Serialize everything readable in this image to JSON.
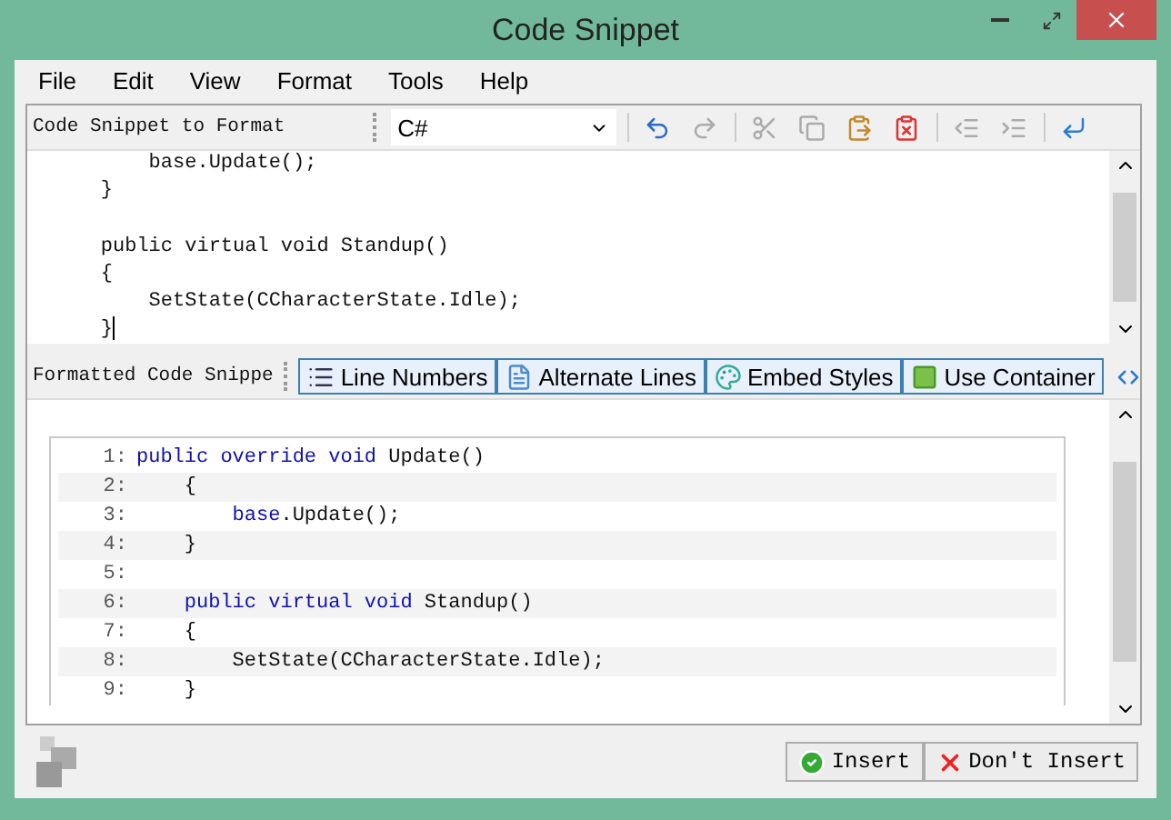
{
  "window": {
    "title": "Code Snippet"
  },
  "menu": [
    "File",
    "Edit",
    "View",
    "Format",
    "Tools",
    "Help"
  ],
  "source_toolbar": {
    "label": "Code Snippet to Format",
    "language": "C#"
  },
  "source_lines": [
    {
      "text": "        base.Update();"
    },
    {
      "text": "    }"
    },
    {
      "text": "    public virtual void Standup()",
      "blank_before": true
    },
    {
      "text": "    {"
    },
    {
      "text": "        SetState(CCharacterState.Idle);"
    },
    {
      "text": "    }"
    }
  ],
  "format_toolbar": {
    "label": "Formatted Code Snippe",
    "toggles": [
      {
        "label": "Line Numbers",
        "kind": "lines",
        "checked": true
      },
      {
        "label": "Alternate Lines",
        "kind": "page",
        "checked": true
      },
      {
        "label": "Embed Styles",
        "kind": "styles",
        "checked": true
      },
      {
        "label": "Use Container",
        "kind": "container",
        "checked": true
      }
    ]
  },
  "preview_lines": [
    {
      "number": "1:",
      "parts": [
        {
          "text": "public override void",
          "kind": "keyword"
        },
        {
          "text": " Update()",
          "kind": "plain"
        }
      ]
    },
    {
      "number": "2:",
      "parts": [
        {
          "text": "    {",
          "kind": "plain"
        }
      ]
    },
    {
      "number": "3:",
      "parts": [
        {
          "text": "        base",
          "kind": "keyword"
        },
        {
          "text": ".Update();",
          "kind": "plain"
        }
      ]
    },
    {
      "number": "4:",
      "parts": [
        {
          "text": "    }",
          "kind": "plain"
        }
      ]
    },
    {
      "number": "5:"
    },
    {
      "number": "6:",
      "parts": [
        {
          "text": "    public virtual void",
          "kind": "keyword"
        },
        {
          "text": " Standup()",
          "kind": "plain"
        }
      ]
    },
    {
      "number": "7:",
      "parts": [
        {
          "text": "    {",
          "kind": "plain"
        }
      ]
    },
    {
      "number": "8:",
      "parts": [
        {
          "text": "        SetState(CCharacterState.Idle);",
          "kind": "plain"
        }
      ]
    },
    {
      "number": "9:",
      "parts": [
        {
          "text": "    }",
          "kind": "plain"
        }
      ]
    }
  ],
  "buttons": [
    {
      "label": "Insert",
      "kind": "ok"
    },
    {
      "label": "Don't Insert",
      "kind": "cancel"
    }
  ]
}
